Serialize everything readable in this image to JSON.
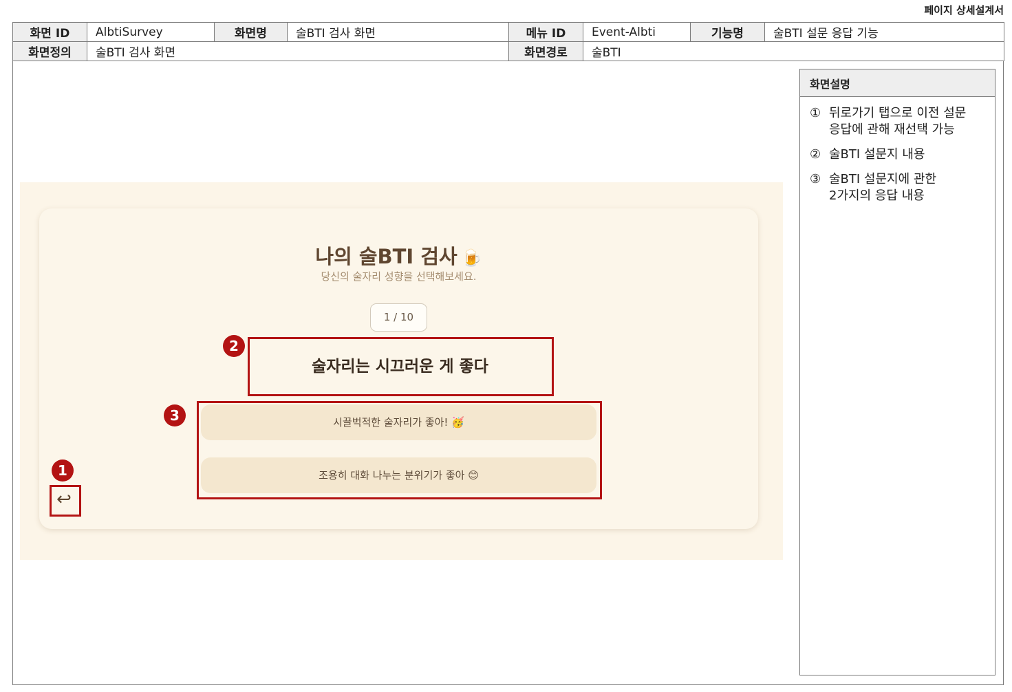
{
  "doc_title": "페이지 상세설계서",
  "meta": {
    "screen_id_label": "화면 ID",
    "screen_id": "AlbtiSurvey",
    "screen_name_label": "화면명",
    "screen_name": "술BTI 검사 화면",
    "menu_id_label": "메뉴 ID",
    "menu_id": "Event-Albti",
    "function_label": "기능명",
    "function_name": "술BTI 설문 응답 기능",
    "definition_label": "화면정의",
    "definition": "술BTI 검사 화면",
    "path_label": "화면경로",
    "path": "술BTI"
  },
  "description": {
    "title": "화면설명",
    "items": [
      {
        "num": "①",
        "text": "뒤로가기 탭으로 이전 설문\n응답에 관해 재선택 가능"
      },
      {
        "num": "②",
        "text": "술BTI 설문지 내용"
      },
      {
        "num": "③",
        "text": "술BTI 설문지에 관한\n2가지의 응답 내용"
      }
    ]
  },
  "screen": {
    "title": "나의 술BTI 검사",
    "title_icon": "🍺",
    "subtitle": "당신의 술자리 성향을 선택해보세요.",
    "progress": "1 / 10",
    "progress_value": {
      "current": 1,
      "total": 10
    },
    "question": "술자리는 시끄러운 게 좋다",
    "options": [
      "시끌벅적한 술자리가 좋아! 🥳",
      "조용히 대화 나누는 분위기가 좋아 😊"
    ],
    "back_icon": "↩"
  },
  "markers": [
    "1",
    "2",
    "3"
  ],
  "colors": {
    "highlight": "#b31313",
    "screen_bg": "#fcf5e8",
    "option_bg": "#f4e7cf",
    "title_text": "#5f4630"
  }
}
